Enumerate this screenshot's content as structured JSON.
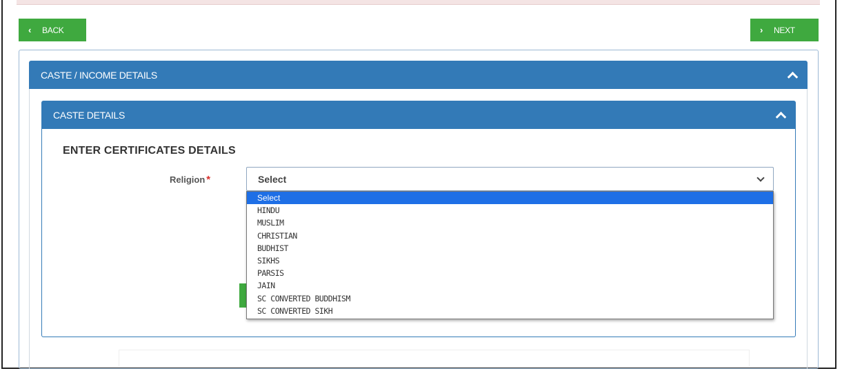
{
  "nav": {
    "back_label": "BACK",
    "next_label": "NEXT"
  },
  "panels": {
    "outer_title": "CASTE / INCOME DETAILS",
    "inner_title": "CASTE DETAILS"
  },
  "form": {
    "section_title": "ENTER CERTIFICATES DETAILS",
    "religion_label": "Religion",
    "required_mark": "*",
    "religion_value": "Select",
    "religion_options": [
      "Select",
      "HINDU",
      "MUSLIM",
      "CHRISTIAN",
      "BUDHIST",
      "SIKHS",
      "PARSIS",
      "JAIN",
      "SC CONVERTED BUDDHISM",
      "SC CONVERTED SIKH"
    ],
    "highlighted_option": "Select"
  },
  "colors": {
    "header_blue": "#337ab7",
    "button_green": "#3fa93f",
    "required_red": "#d9302c",
    "highlight_blue": "#1e6fe6"
  }
}
